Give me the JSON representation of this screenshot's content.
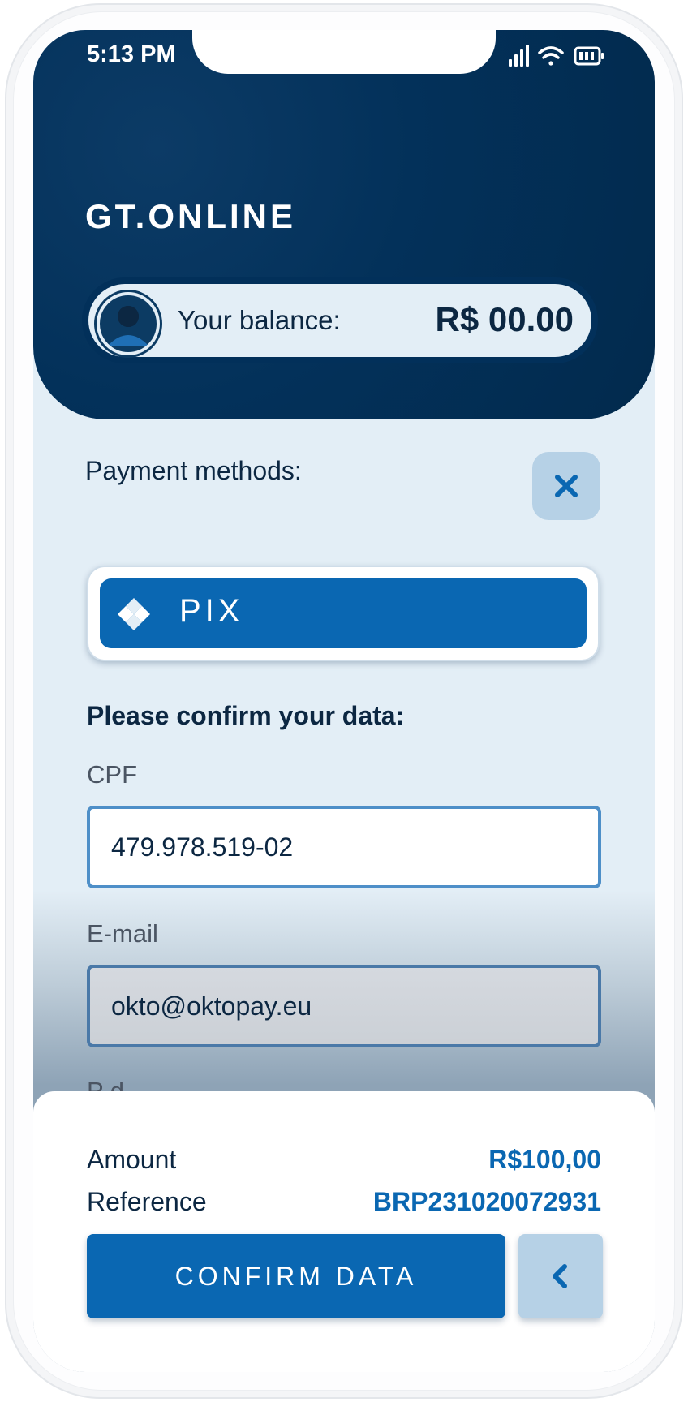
{
  "status_bar": {
    "time": "5:13 PM",
    "icons": [
      "signal-icon",
      "wifi-icon",
      "battery-icon"
    ]
  },
  "header": {
    "brand": "GT.ONLINE"
  },
  "balance": {
    "label": "Your balance:",
    "amount": "R$ 00.00"
  },
  "payment": {
    "label": "Payment methods:",
    "close_icon": "close-icon",
    "method": "PIX"
  },
  "form": {
    "title": "Please confirm your data:",
    "cpf_label": "CPF",
    "cpf_value": "479.978.519-02",
    "email_label": "E-mail",
    "email_value": "okto@oktopay.eu",
    "partial_label": "P        d"
  },
  "summary": {
    "amount_label": "Amount",
    "amount_value": "R$100,00",
    "reference_label": "Reference",
    "reference_value": "BRP231020072931"
  },
  "actions": {
    "confirm_label": "CONFIRM DATA",
    "back_icon": "chevron-left-icon"
  },
  "colors": {
    "header": "#02305a",
    "accent": "#0a67b2",
    "light_accent": "#b6d1e6",
    "background": "#e3eef6"
  }
}
